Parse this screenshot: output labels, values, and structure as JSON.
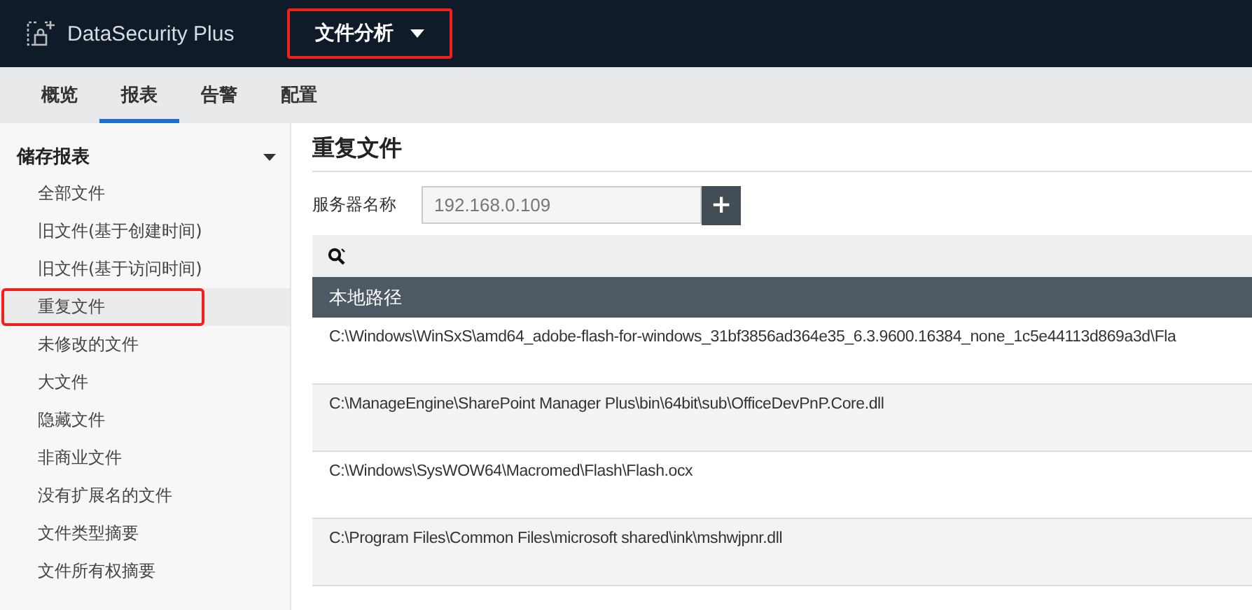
{
  "header": {
    "product": "DataSecurity Plus",
    "module": {
      "label": "文件分析",
      "highlighted": true
    }
  },
  "tabs": [
    {
      "label": "概览",
      "selected": false
    },
    {
      "label": "报表",
      "selected": true
    },
    {
      "label": "告警",
      "selected": false
    },
    {
      "label": "配置",
      "selected": false
    }
  ],
  "sidebar": {
    "section": {
      "title": "储存报表",
      "expanded": true
    },
    "items": [
      {
        "label": "全部文件",
        "selected": false,
        "highlighted": false
      },
      {
        "label": "旧文件(基于创建时间)",
        "selected": false,
        "highlighted": false
      },
      {
        "label": "旧文件(基于访问时间)",
        "selected": false,
        "highlighted": false
      },
      {
        "label": "重复文件",
        "selected": true,
        "highlighted": true
      },
      {
        "label": "未修改的文件",
        "selected": false,
        "highlighted": false
      },
      {
        "label": "大文件",
        "selected": false,
        "highlighted": false
      },
      {
        "label": "隐藏文件",
        "selected": false,
        "highlighted": false
      },
      {
        "label": "非商业文件",
        "selected": false,
        "highlighted": false
      },
      {
        "label": "没有扩展名的文件",
        "selected": false,
        "highlighted": false
      },
      {
        "label": "文件类型摘要",
        "selected": false,
        "highlighted": false
      },
      {
        "label": "文件所有权摘要",
        "selected": false,
        "highlighted": false
      }
    ]
  },
  "report": {
    "title": "重复文件",
    "server": {
      "label": "服务器名称",
      "value": "192.168.0.109",
      "add": "+"
    },
    "table": {
      "columns": [
        "本地路径"
      ],
      "rows": [
        [
          "C:\\Windows\\WinSxS\\amd64_adobe-flash-for-windows_31bf3856ad364e35_6.3.9600.16384_none_1c5e44113d869a3d\\Fla"
        ],
        [
          "C:\\ManageEngine\\SharePoint Manager Plus\\bin\\64bit\\sub\\OfficeDevPnP.Core.dll"
        ],
        [
          "C:\\Windows\\SysWOW64\\Macromed\\Flash\\Flash.ocx"
        ],
        [
          "C:\\Program Files\\Common Files\\microsoft shared\\ink\\mshwjpnr.dll"
        ]
      ]
    }
  }
}
